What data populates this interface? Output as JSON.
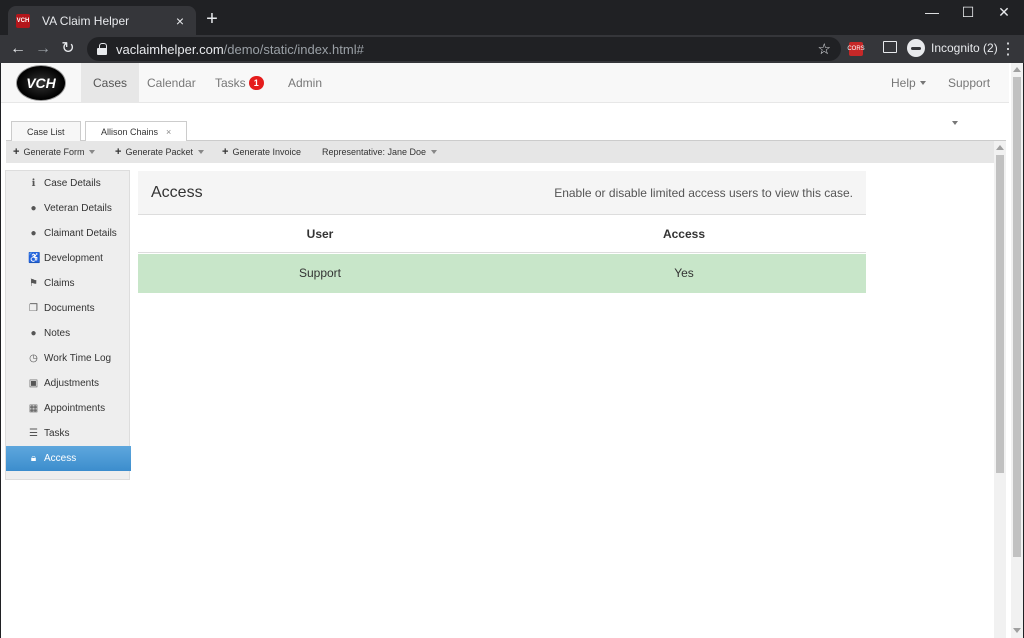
{
  "browser": {
    "tab_title": "VA Claim Helper",
    "url_host": "vaclaimhelper.com",
    "url_path": "/demo/static/index.html#",
    "incognito_label": "Incognito (2)",
    "icons": [
      "back-arrow-icon",
      "forward-arrow-icon",
      "reload-icon",
      "lock-icon",
      "star-icon",
      "cast-icon",
      "incognito-icon",
      "menu-icon"
    ]
  },
  "app": {
    "logo_text": "VCH",
    "nav": [
      {
        "label": "Cases"
      },
      {
        "label": "Calendar"
      },
      {
        "label": "Tasks",
        "badge": "1"
      },
      {
        "label": "Admin"
      }
    ],
    "nav_right": [
      {
        "label": "Help"
      },
      {
        "label": "Support"
      }
    ]
  },
  "inner_tabs": [
    {
      "label": "Case List"
    },
    {
      "label": "Allison Chains",
      "close": "×"
    }
  ],
  "actions": {
    "generate_form": "Generate Form",
    "generate_packet": "Generate Packet",
    "generate_invoice": "Generate Invoice",
    "representative": "Representative: Jane Doe"
  },
  "sidebar": {
    "items": [
      {
        "label": "Case Details",
        "icon": "info-icon"
      },
      {
        "label": "Veteran Details",
        "icon": "user-icon"
      },
      {
        "label": "Claimant Details",
        "icon": "user-icon"
      },
      {
        "label": "Development",
        "icon": "wheelchair-icon"
      },
      {
        "label": "Claims",
        "icon": "flag-icon"
      },
      {
        "label": "Documents",
        "icon": "copy-icon"
      },
      {
        "label": "Notes",
        "icon": "comment-icon"
      },
      {
        "label": "Work Time Log",
        "icon": "clock-icon"
      },
      {
        "label": "Adjustments",
        "icon": "money-icon"
      },
      {
        "label": "Appointments",
        "icon": "calendar-icon"
      },
      {
        "label": "Tasks",
        "icon": "list-icon"
      },
      {
        "label": "Access",
        "icon": "lock-icon",
        "active": true
      }
    ]
  },
  "panel": {
    "title": "Access",
    "description": "Enable or disable limited access users to view this case.",
    "columns": [
      "User",
      "Access"
    ],
    "rows": [
      {
        "user": "Support",
        "access": "Yes"
      }
    ]
  },
  "colors": {
    "accent_active": "#3c8dcd",
    "row_highlight": "#c8e6c9",
    "badge": "#e51c1c"
  }
}
